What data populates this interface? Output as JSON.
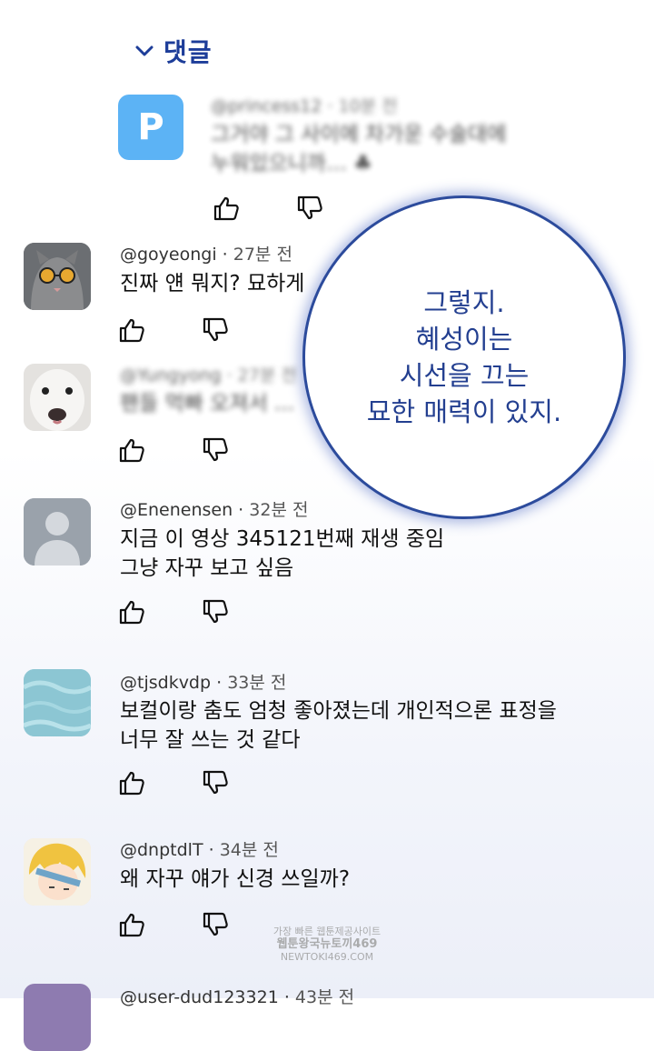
{
  "header": {
    "title": "댓글"
  },
  "comments": [
    {
      "avatar_letter": "P",
      "user": "@princess12",
      "time": "10분 전",
      "lines": [
        "그거야 그 사이에 차가운 수술대에",
        "누워있으니까… ♣"
      ],
      "blurred": true
    },
    {
      "user": "@goyeongi",
      "time": "27분 전",
      "lines": [
        "진짜 얜 뭐지? 묘하게"
      ],
      "blurred": false
    },
    {
      "user": "@Yungyong",
      "time": "27분 전",
      "lines": [
        "팬들 먹빠 오져서 ..."
      ],
      "blurred": true
    },
    {
      "user": "@Enenensen",
      "time": "32분 전",
      "lines": [
        "지금 이 영상 345121번째 재생 중임",
        "그냥 자꾸 보고 싶음"
      ],
      "blurred": false
    },
    {
      "user": "@tjsdkvdp",
      "time": "33분 전",
      "lines": [
        "보컬이랑 춤도 엄청 좋아졌는데 개인적으론 표정을",
        "너무 잘 쓰는 것 같다"
      ],
      "blurred": false
    },
    {
      "user": "@dnptdlT",
      "time": "34분 전",
      "lines": [
        "왜 자꾸 얘가 신경 쓰일까?"
      ],
      "blurred": false
    },
    {
      "user": "@user-dud123321",
      "time": "43분 전",
      "lines": [],
      "blurred": false
    }
  ],
  "speech_bubble": {
    "lines": [
      "그렇지.",
      "혜성이는",
      "시선을 끄는",
      "묘한 매력이 있지."
    ]
  },
  "watermark": {
    "lines": [
      "가장 빠른 웹툰제공사이트",
      "웹툰왕국뉴토끼469",
      "NEWTOKI469.COM"
    ]
  },
  "colors": {
    "accent": "#1d3d99",
    "bubble_border": "#2c4b9c",
    "p_avatar": "#5cb3f5"
  },
  "icons": {
    "like": "thumbs-up-icon",
    "dislike": "thumbs-down-icon",
    "expand": "chevron-down-icon"
  }
}
